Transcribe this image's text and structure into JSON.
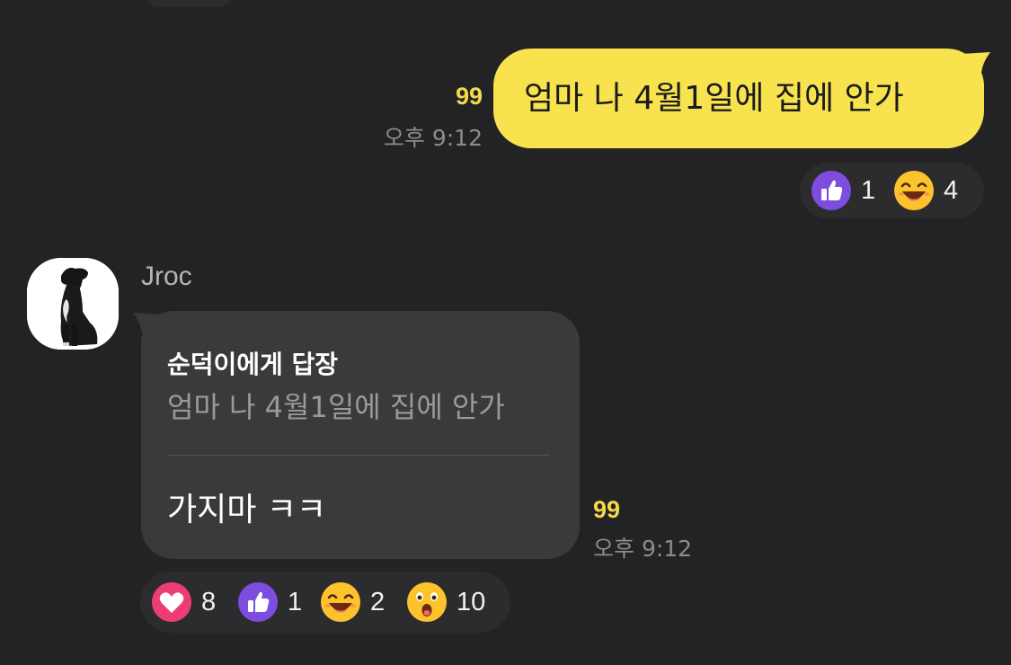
{
  "messages": [
    {
      "direction": "outgoing",
      "text": "엄마 나 4월1일에 집에 안가",
      "unread": "99",
      "time": "오후 9:12",
      "bubble_color": "#f8e34f",
      "reactions": [
        {
          "icon": "thumbs-up-icon",
          "count": "1"
        },
        {
          "icon": "laughing-face-icon",
          "count": "4"
        }
      ]
    },
    {
      "direction": "incoming",
      "sender": "Jroc",
      "avatar": "dog-avatar",
      "reply_to": {
        "title": "순덕이에게 답장",
        "quote": "엄마 나 4월1일에 집에 안가"
      },
      "text": "가지마 ㅋㅋ",
      "unread": "99",
      "time": "오후 9:12",
      "bubble_color": "#3a393c",
      "reactions": [
        {
          "icon": "heart-icon",
          "count": "8"
        },
        {
          "icon": "thumbs-up-icon",
          "count": "1"
        },
        {
          "icon": "laughing-face-icon",
          "count": "2"
        },
        {
          "icon": "surprised-face-icon",
          "count": "10"
        }
      ]
    }
  ],
  "colors": {
    "background": "#232224",
    "unread_accent": "#f2da4a",
    "heart": "#ee3d74",
    "like": "#7d4de0",
    "emoji_yellow": "#fcc32c"
  }
}
